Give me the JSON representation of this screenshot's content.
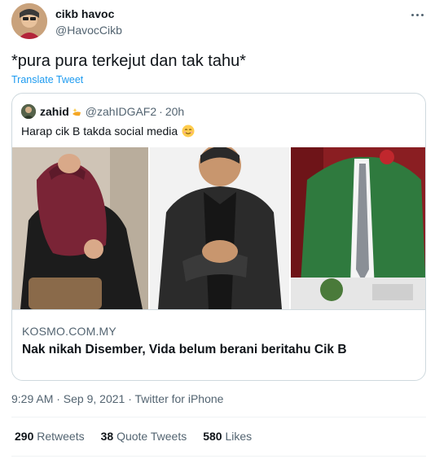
{
  "author": {
    "display_name": "cikb havoc",
    "handle": "@HavocCikb"
  },
  "tweet": {
    "text": "*pura pura terkejut dan tak tahu*",
    "translate_label": "Translate Tweet"
  },
  "quoted": {
    "display_name": "zahid",
    "handle": "@zahIDGAF2",
    "separator": "·",
    "time": "20h",
    "text": "Harap cik B takda social media",
    "link_domain": "KOSMO.COM.MY",
    "link_title": "Nak nikah Disember, Vida belum berani beritahu Cik B"
  },
  "meta": {
    "timestamp": "9:29 AM · Sep 9, 2021 · Twitter for iPhone"
  },
  "stats": [
    {
      "count": "290",
      "label": "Retweets"
    },
    {
      "count": "38",
      "label": "Quote Tweets"
    },
    {
      "count": "580",
      "label": "Likes"
    }
  ],
  "colors": {
    "link_blue": "#1d9bf0",
    "secondary_text": "#536471",
    "border": "#cfd9de"
  },
  "icons": {
    "more": "more-horizontal-icon",
    "quoted_name_emoji": "sparkle-emoji-icon",
    "quoted_text_emoji": "relieved-face-emoji-icon"
  }
}
